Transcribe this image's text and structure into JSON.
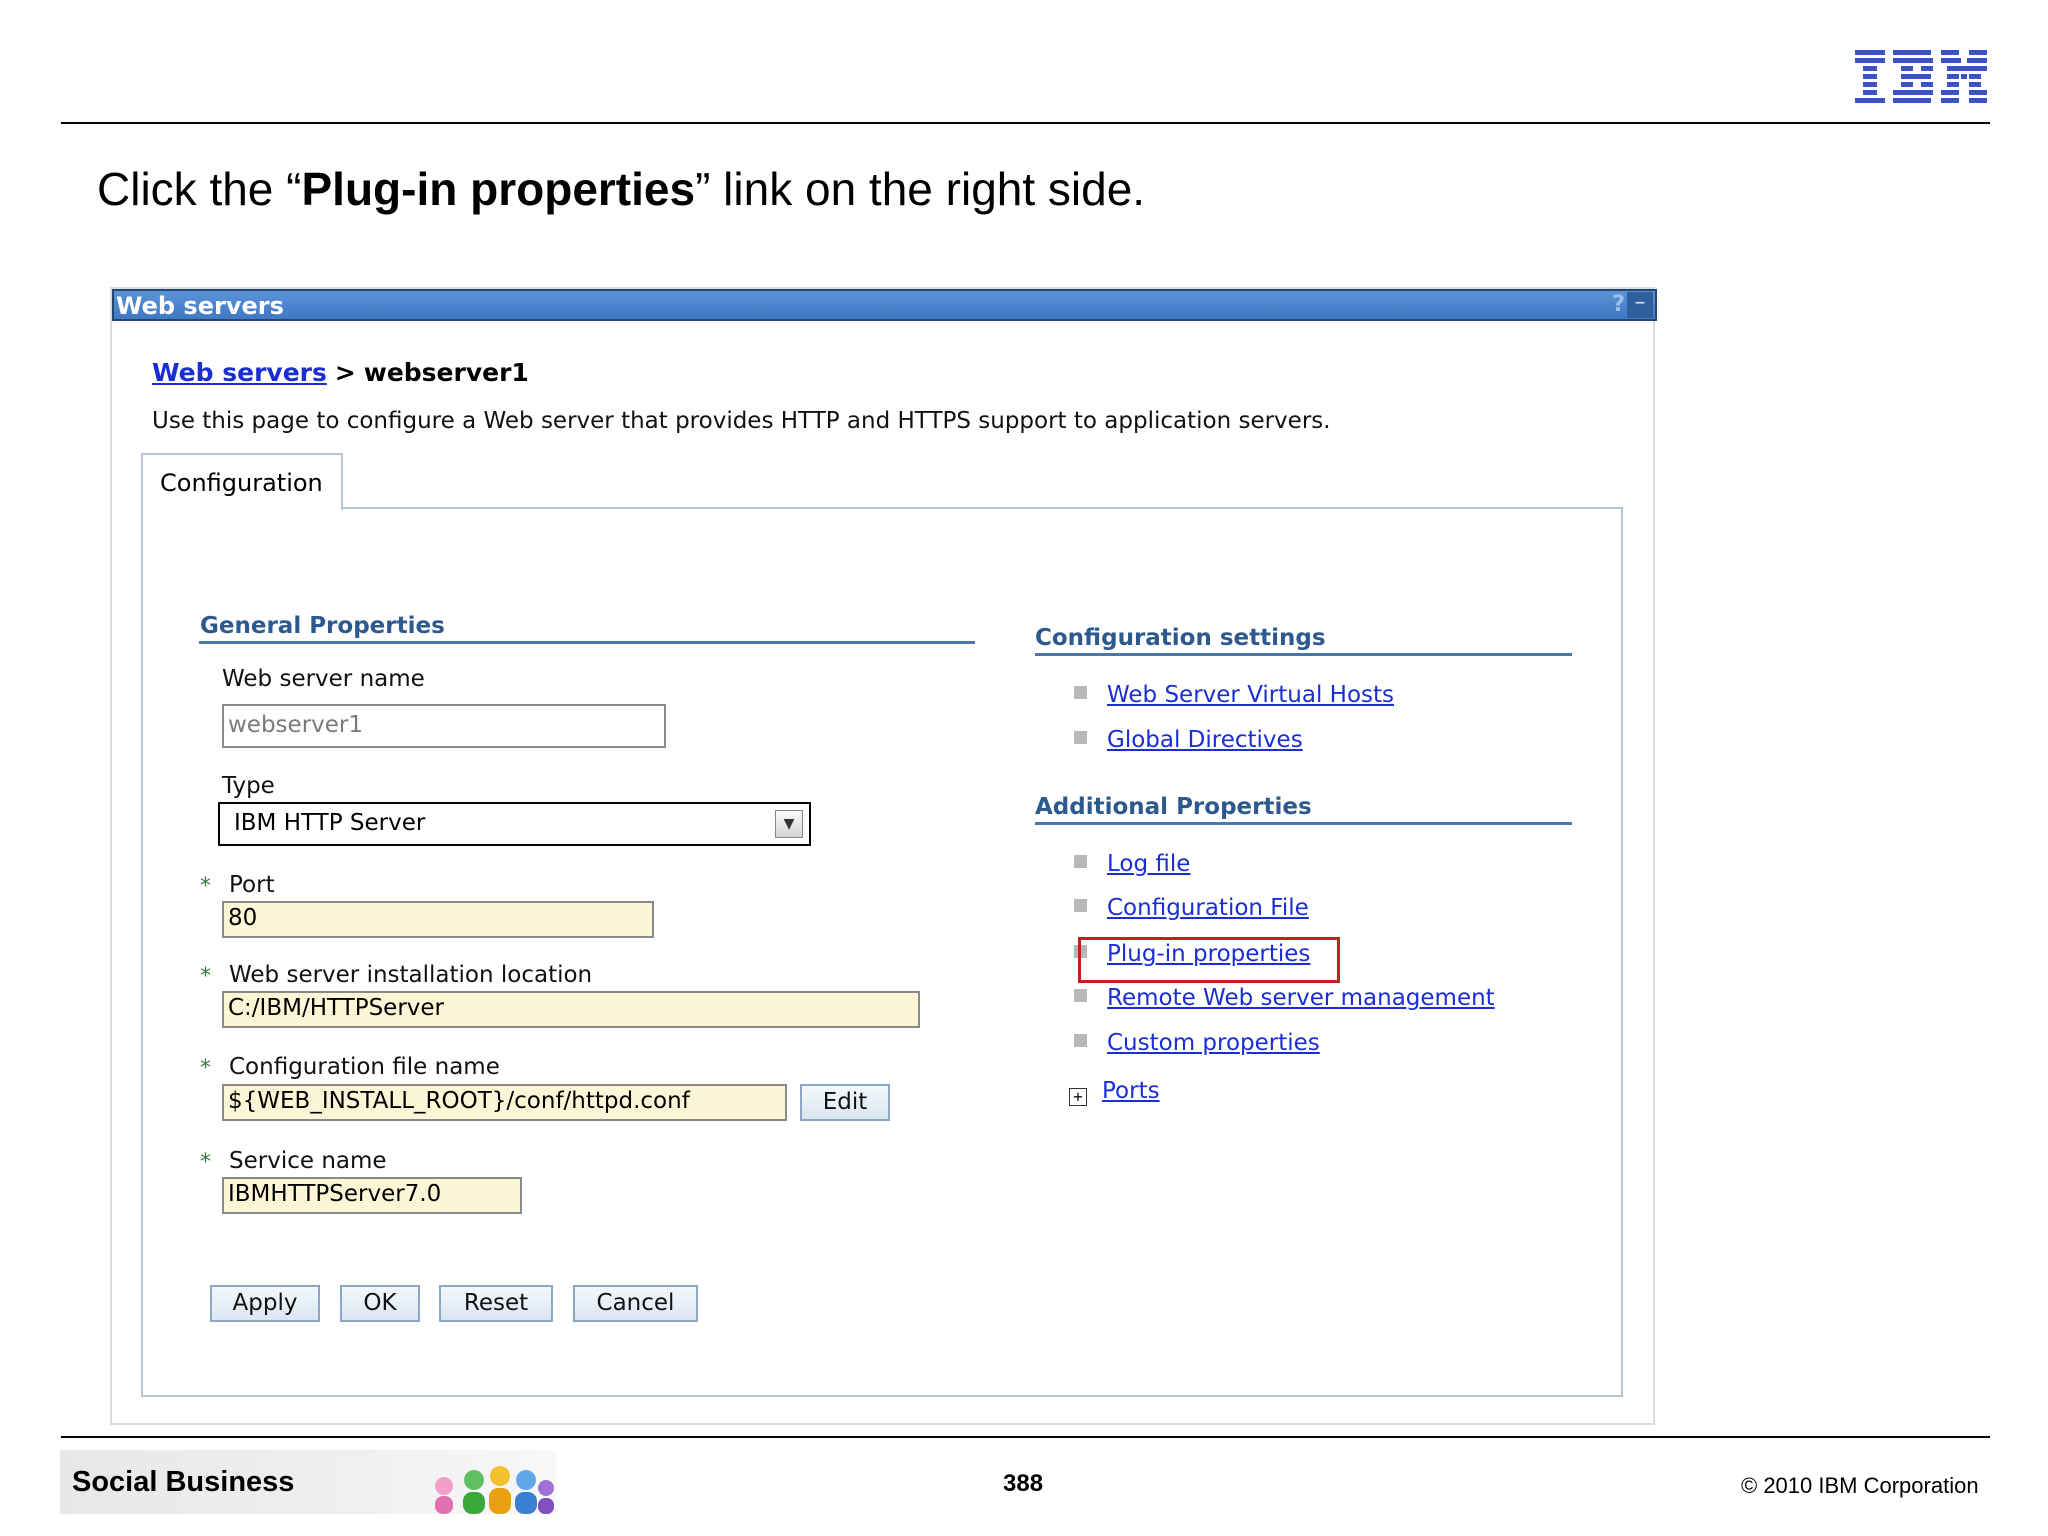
{
  "slide": {
    "logo_text": "IBM",
    "instruction_prefix": "Click the “",
    "instruction_bold": "Plug-in properties",
    "instruction_suffix": "” link on the right side.",
    "footer_banner": "Social Business",
    "page_number": "388",
    "copyright": "© 2010 IBM Corporation"
  },
  "portlet": {
    "title": "Web servers",
    "help_icon": "?",
    "minimize_icon": "–"
  },
  "breadcrumb": {
    "link": "Web servers",
    "separator": ">",
    "current": "webserver1"
  },
  "page_description": "Use this page to configure a Web server that provides HTTP and HTTPS support to application servers.",
  "tab": {
    "label": "Configuration"
  },
  "general_properties": {
    "heading": "General Properties",
    "web_server_name": {
      "label": "Web server name",
      "value": "webserver1"
    },
    "type": {
      "label": "Type",
      "value": "IBM HTTP Server"
    },
    "port": {
      "label": "Port",
      "value": "80"
    },
    "install_location": {
      "label": "Web server installation location",
      "value": "C:/IBM/HTTPServer"
    },
    "config_file": {
      "label": "Configuration file name",
      "value": "${WEB_INSTALL_ROOT}/conf/httpd.conf",
      "edit_label": "Edit"
    },
    "service_name": {
      "label": "Service name",
      "value": "IBMHTTPServer7.0"
    },
    "required_marker": "*"
  },
  "buttons": {
    "apply": "Apply",
    "ok": "OK",
    "reset": "Reset",
    "cancel": "Cancel"
  },
  "configuration_settings": {
    "heading": "Configuration settings",
    "links": [
      "Web Server Virtual Hosts",
      "Global Directives"
    ]
  },
  "additional_properties": {
    "heading": "Additional Properties",
    "links": [
      "Log file",
      "Configuration File",
      "Plug-in properties",
      "Remote Web server management",
      "Custom properties"
    ],
    "expandable": {
      "label": "Ports",
      "icon": "+"
    }
  },
  "colors": {
    "title_bar": "#4a84cc",
    "link": "#1a2ed4",
    "section_heading": "#2d5a8e",
    "required_field_bg": "#fdf6d6",
    "highlight_box": "#c81e1e",
    "ibm_logo": "#3a54c8"
  }
}
